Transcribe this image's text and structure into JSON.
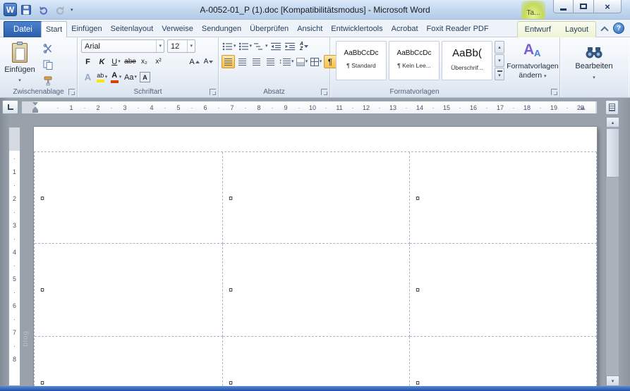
{
  "colors": {
    "highlight_orange": "#fbd06b",
    "file_tab_blue": "#2b5da8",
    "taskbar_blue": "#2c5fb0",
    "font_color_red": "#e03c00",
    "highlight_yellow": "#ffe400"
  },
  "icons": {
    "dropdown": "▾",
    "window_close": "×",
    "help": "?",
    "scroll_up": "▴",
    "scroll_down": "▾",
    "marker_dot": "·",
    "updown_arrow": "↕"
  },
  "titlebar": {
    "app_icon": "W",
    "title": "A-0052-01_P (1).doc [Kompatibilitätsmodus]  -  Microsoft Word",
    "contextual_group_overflow": "Ta..."
  },
  "tabs": {
    "file": "Datei",
    "items": [
      "Start",
      "Einfügen",
      "Seitenlayout",
      "Verweise",
      "Sendungen",
      "Überprüfen",
      "Ansicht",
      "Entwicklertools",
      "Acrobat",
      "Foxit Reader PDF"
    ],
    "active": "Start",
    "contextual": [
      "Entwurf",
      "Layout"
    ]
  },
  "ribbon": {
    "clipboard": {
      "group": "Zwischenablage",
      "paste": "Einfügen"
    },
    "font": {
      "group": "Schriftart",
      "family": "Arial",
      "size": "12",
      "bold": "F",
      "italic": "K",
      "underline": "U",
      "strikethrough": "abe",
      "subscript": "x₂",
      "superscript": "x²",
      "effects": "A",
      "highlight": "ab",
      "font_color": "A",
      "change_case": "Aa",
      "grow": "A",
      "shrink": "A",
      "char_border": "A"
    },
    "paragraph": {
      "group": "Absatz",
      "pilcrow": "¶",
      "sort_a": "A",
      "sort_z": "Z"
    },
    "styles": {
      "group": "Formatvorlagen",
      "gallery": [
        {
          "preview": "AaBbCcDc",
          "name": "¶ Standard"
        },
        {
          "preview": "AaBbCcDc",
          "name": "¶ Kein Lee..."
        },
        {
          "preview": "AaBb(",
          "name": "Überschrif..."
        }
      ],
      "change_line1": "Formatvorlagen",
      "change_line2": "ändern"
    },
    "editing": {
      "group": "Bearbeiten"
    }
  },
  "ruler": {
    "h_numbers": [
      "1",
      "2",
      "3",
      "4",
      "5",
      "6",
      "7",
      "8",
      "9",
      "10",
      "11",
      "12",
      "13",
      "14",
      "15",
      "16",
      "17",
      "18",
      "19",
      "20"
    ],
    "v_numbers": [
      "1",
      "2",
      "3",
      "4",
      "5",
      "6",
      "7",
      "8"
    ]
  },
  "document": {
    "table": {
      "rows": 3,
      "cols": 3,
      "cell_marker": "¤"
    },
    "watermark": "blog"
  }
}
